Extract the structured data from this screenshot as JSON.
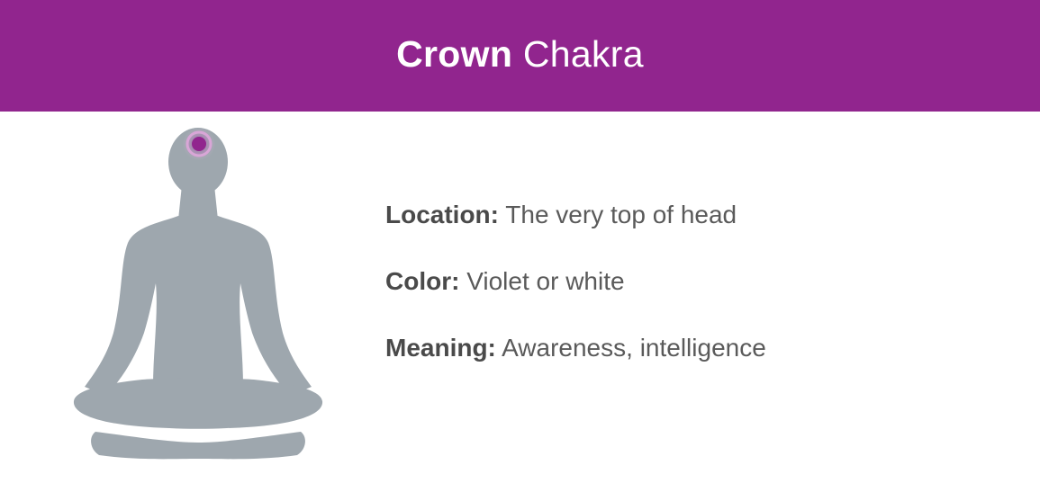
{
  "header": {
    "title_bold": "Crown",
    "title_regular": "Chakra",
    "background_color": "#91258e"
  },
  "figure": {
    "icon": "meditating-person-silhouette",
    "silhouette_color": "#9ea7ae",
    "chakra_marker_color": "#91258e",
    "chakra_position": "top of head"
  },
  "details": [
    {
      "label": "Location:",
      "value": "The very top of head"
    },
    {
      "label": "Color:",
      "value": "Violet or white"
    },
    {
      "label": "Meaning:",
      "value": "Awareness, intelligence"
    }
  ]
}
